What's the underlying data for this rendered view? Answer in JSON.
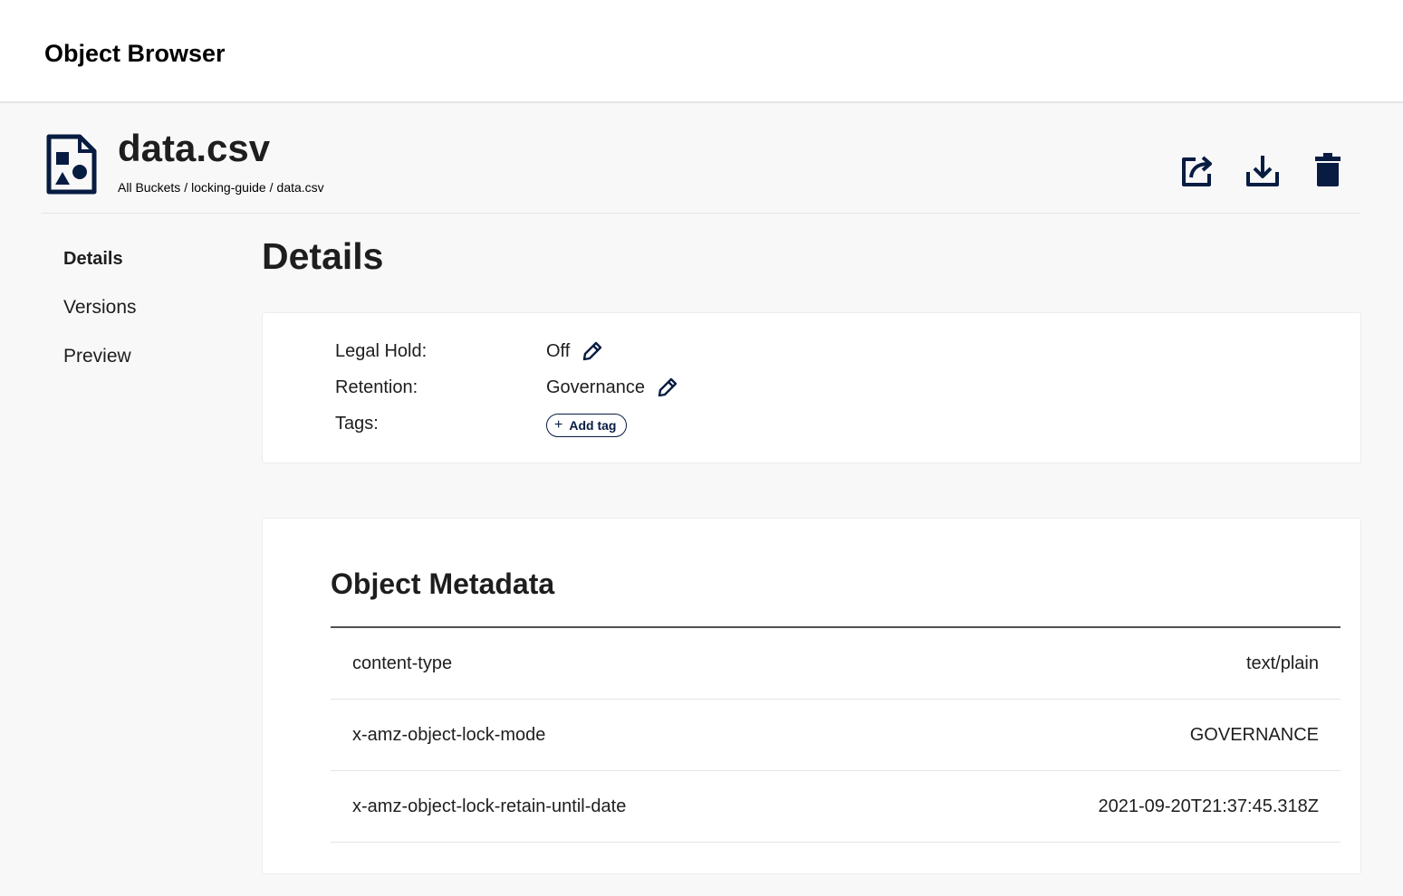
{
  "app": {
    "title": "Object Browser"
  },
  "object": {
    "name": "data.csv",
    "breadcrumb": [
      "All Buckets",
      "/",
      "locking-guide",
      "/",
      "data.csv"
    ]
  },
  "actions": {
    "share": "share-icon",
    "download": "download-icon",
    "delete": "trash-icon"
  },
  "nav": {
    "items": [
      {
        "label": "Details",
        "active": true
      },
      {
        "label": "Versions",
        "active": false
      },
      {
        "label": "Preview",
        "active": false
      }
    ]
  },
  "details": {
    "title": "Details",
    "legal_hold": {
      "label": "Legal Hold:",
      "value": "Off"
    },
    "retention": {
      "label": "Retention:",
      "value": "Governance"
    },
    "tags": {
      "label": "Tags:",
      "add_label": "Add tag",
      "add_icon": "+"
    }
  },
  "metadata": {
    "title": "Object Metadata",
    "rows": [
      {
        "key": "content-type",
        "value": "text/plain"
      },
      {
        "key": "x-amz-object-lock-mode",
        "value": "GOVERNANCE"
      },
      {
        "key": "x-amz-object-lock-retain-until-date",
        "value": "2021-09-20T21:37:45.318Z"
      }
    ]
  },
  "colors": {
    "icon": "#081c42",
    "background": "#f8f8f8",
    "card": "#ffffff"
  }
}
